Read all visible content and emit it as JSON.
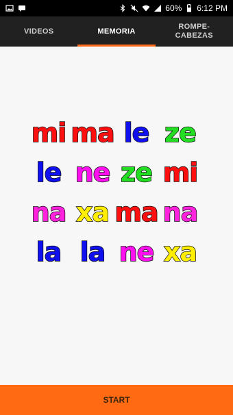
{
  "status_bar": {
    "battery": "60%",
    "time": "6:12 PM"
  },
  "tabs": [
    {
      "label": "VIDEOS",
      "active": false
    },
    {
      "label": "MEMORIA",
      "active": true
    },
    {
      "label": "ROMPE-\nCABEZAS",
      "active": false
    }
  ],
  "grid": {
    "rows": [
      [
        {
          "text": "mi",
          "color": "#ff1010"
        },
        {
          "text": "ma",
          "color": "#ff1010"
        },
        {
          "text": "le",
          "color": "#1010ee"
        },
        {
          "text": "ze",
          "color": "#22dd22"
        }
      ],
      [
        {
          "text": "le",
          "color": "#1010ee"
        },
        {
          "text": "ne",
          "color": "#ff10ee"
        },
        {
          "text": "ze",
          "color": "#22dd22"
        },
        {
          "text": "mi",
          "color": "#ff1010"
        }
      ],
      [
        {
          "text": "na",
          "color": "#ff22dd"
        },
        {
          "text": "xa",
          "color": "#ffee00"
        },
        {
          "text": "ma",
          "color": "#ff1010"
        },
        {
          "text": "na",
          "color": "#ff22dd"
        }
      ],
      [
        {
          "text": "la",
          "color": "#1010ee"
        },
        {
          "text": "la",
          "color": "#1010ee"
        },
        {
          "text": "ne",
          "color": "#ff10ee"
        },
        {
          "text": "xa",
          "color": "#ffee00"
        }
      ]
    ]
  },
  "start_button": {
    "label": "START",
    "color": "#ff6a12"
  },
  "accent_color": "#ff6a1a"
}
